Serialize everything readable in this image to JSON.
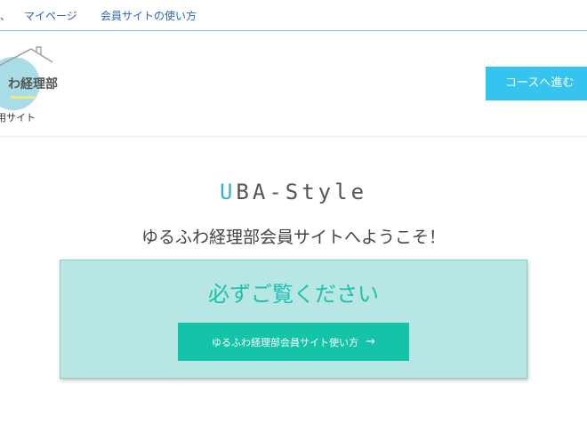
{
  "top_nav": {
    "partial_item": "、",
    "items": [
      {
        "label": "マイページ"
      },
      {
        "label": "会員サイトの使い方"
      }
    ]
  },
  "header": {
    "logo_text": "わ経理部",
    "site_subtitle": "用サイト",
    "course_button": "コースへ進む"
  },
  "main": {
    "brand_u": "U",
    "brand_rest": "BA-Style",
    "welcome": "ゆるふわ経理部会員サイトへようこそ！",
    "notice_title": "必ずご覧ください",
    "notice_button": "ゆるふわ経理部会員サイト使い方",
    "notice_button_icon": "→"
  },
  "colors": {
    "nav_link": "#2a64c0",
    "course_button": "#35c4ef",
    "notice_bg": "#b8e6e2",
    "notice_title": "#1dbfae",
    "notice_button": "#15c3a8"
  }
}
